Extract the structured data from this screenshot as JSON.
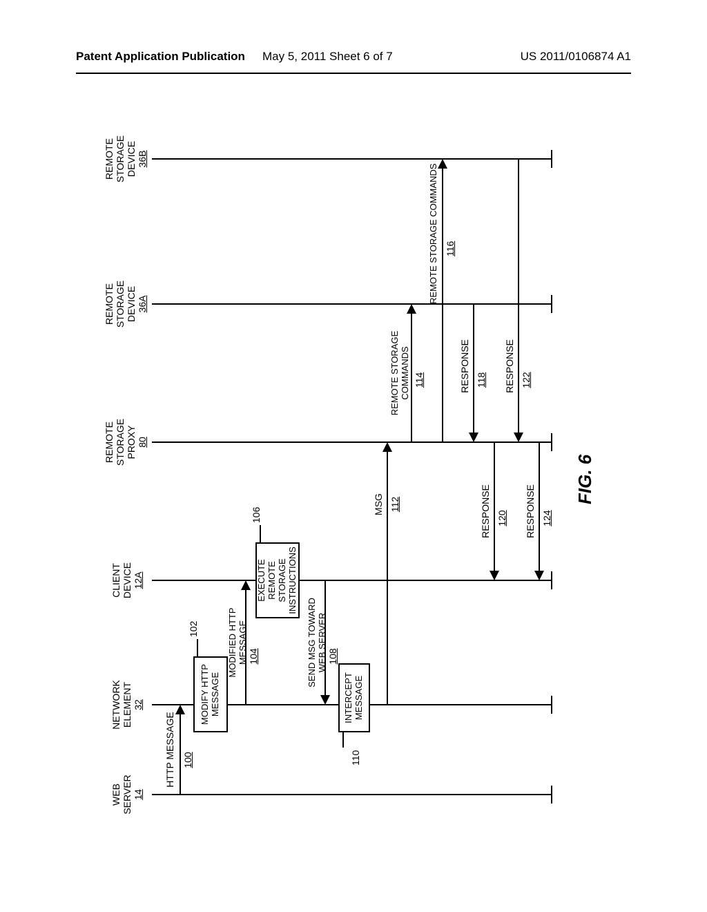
{
  "header": {
    "left": "Patent Application Publication",
    "center": "May 5, 2011  Sheet 6 of 7",
    "right": "US 2011/0106874 A1"
  },
  "figure_label": "FIG. 6",
  "lanes": {
    "web_server": {
      "title": "WEB SERVER",
      "ref": "14"
    },
    "network_element": {
      "title": "NETWORK ELEMENT",
      "ref": "32"
    },
    "client_device": {
      "title": "CLIENT DEVICE",
      "ref": "12A"
    },
    "remote_storage_proxy": {
      "title": "REMOTE STORAGE PROXY",
      "ref": "80"
    },
    "remote_storage_a": {
      "title": "REMOTE STORAGE DEVICE",
      "ref": "36A"
    },
    "remote_storage_b": {
      "title": "REMOTE STORAGE DEVICE",
      "ref": "36B"
    }
  },
  "process_boxes": {
    "modify": {
      "text": "MODIFY HTTP MESSAGE",
      "ref": "102"
    },
    "execute": {
      "text": "EXECUTE REMOTE STORAGE INSTRUCTIONS",
      "ref": "106"
    },
    "intercept": {
      "text": "INTERCEPT MESSAGE",
      "ref": "110"
    }
  },
  "messages": {
    "http_message": {
      "text": "HTTP MESSAGE",
      "ref": "100"
    },
    "modified_http_message": {
      "text": "MODIFIED HTTP MESSAGE",
      "ref": "104"
    },
    "send_msg_toward": {
      "text": "SEND MSG TOWARD WEB SERVER",
      "ref": "108"
    },
    "msg": {
      "text": "MSG",
      "ref": "112"
    },
    "remote_storage_cmds_a": {
      "text": "REMOTE STORAGE COMMANDS",
      "ref": "114"
    },
    "remote_storage_cmds_b": {
      "text": "REMOTE STORAGE COMMANDS",
      "ref": "116"
    },
    "response_118": {
      "text": "RESPONSE",
      "ref": "118"
    },
    "response_120": {
      "text": "RESPONSE",
      "ref": "120"
    },
    "response_122": {
      "text": "RESPONSE",
      "ref": "122"
    },
    "response_124": {
      "text": "RESPONSE",
      "ref": "124"
    }
  }
}
